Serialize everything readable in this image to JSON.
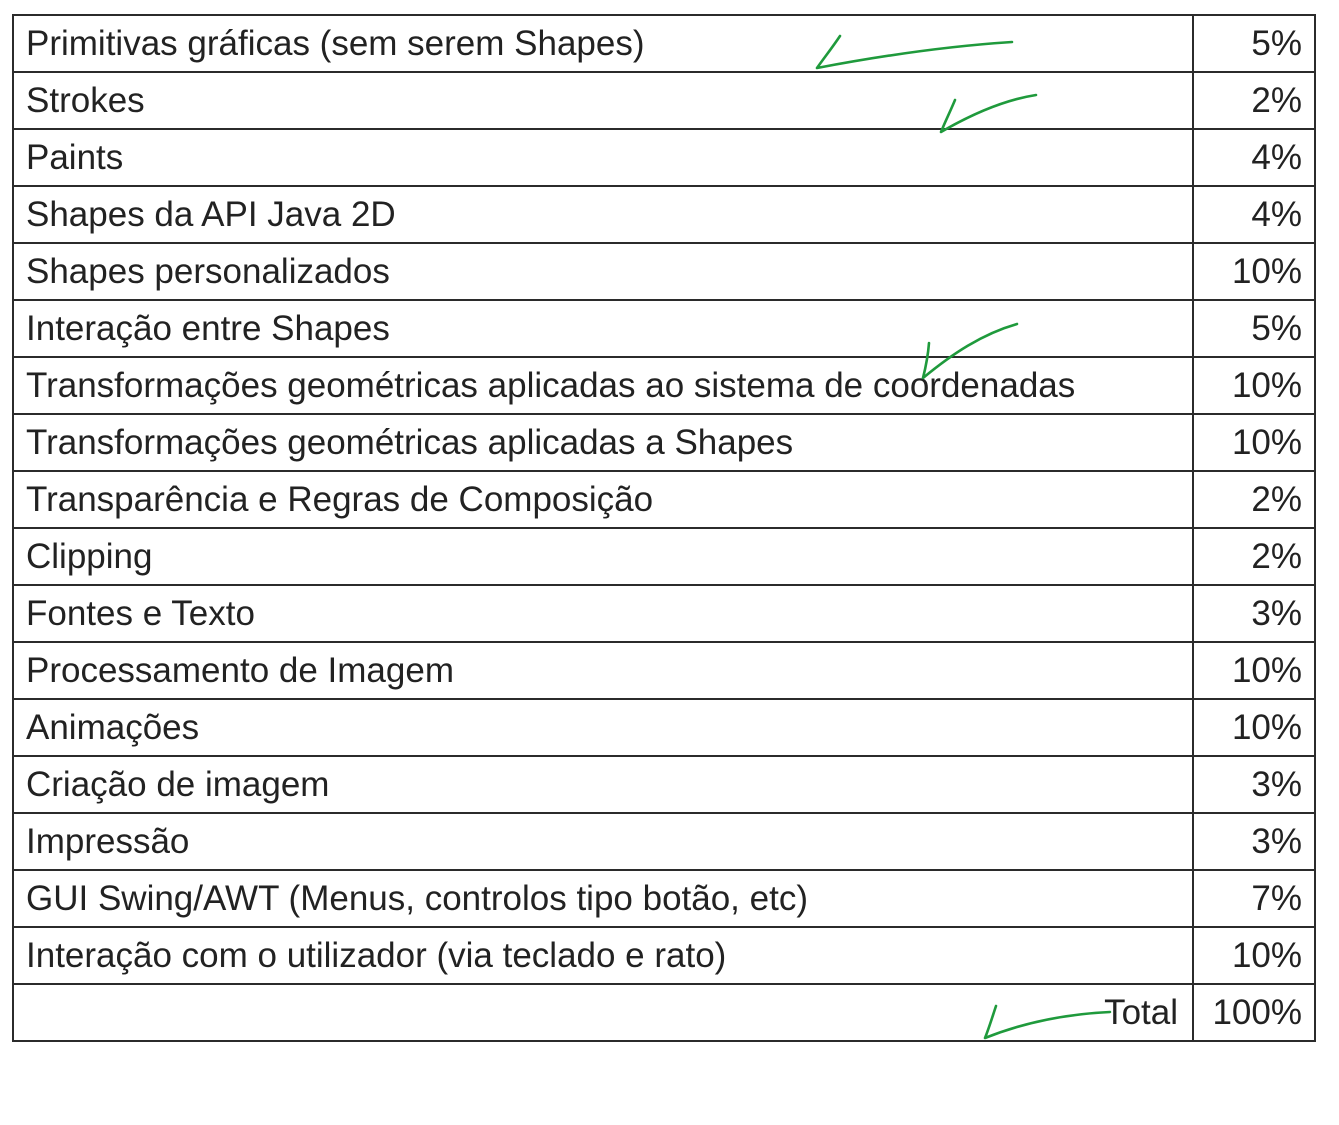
{
  "table": {
    "rows": [
      {
        "topic": "Primitivas gráficas (sem serem Shapes)",
        "weight": "5%",
        "checked": true
      },
      {
        "topic": "Strokes",
        "weight": "2%",
        "checked": true
      },
      {
        "topic": "Paints",
        "weight": "4%",
        "checked": false
      },
      {
        "topic": "Shapes da API Java 2D",
        "weight": "4%",
        "checked": false
      },
      {
        "topic": "Shapes personalizados",
        "weight": "10%",
        "checked": false
      },
      {
        "topic": "Interação entre Shapes",
        "weight": "5%",
        "checked": true
      },
      {
        "topic": "Transformações geométricas aplicadas ao sistema de coordenadas",
        "weight": "10%",
        "checked": false
      },
      {
        "topic": "Transformações geométricas aplicadas a Shapes",
        "weight": "10%",
        "checked": false
      },
      {
        "topic": "Transparência e Regras de Composição",
        "weight": "2%",
        "checked": false
      },
      {
        "topic": "Clipping",
        "weight": "2%",
        "checked": false
      },
      {
        "topic": "Fontes e Texto",
        "weight": "3%",
        "checked": false
      },
      {
        "topic": "Processamento de Imagem",
        "weight": "10%",
        "checked": false
      },
      {
        "topic": "Animações",
        "weight": "10%",
        "checked": false
      },
      {
        "topic": "Criação de imagem",
        "weight": "3%",
        "checked": false
      },
      {
        "topic": "Impressão",
        "weight": "3%",
        "checked": false
      },
      {
        "topic": "GUI Swing/AWT (Menus, controlos tipo botão, etc)",
        "weight": "7%",
        "checked": false
      },
      {
        "topic": "Interação com o utilizador (via teclado e rato)",
        "weight": "10%",
        "checked": true
      }
    ],
    "total_label": "Total",
    "total_value": "100%"
  },
  "annotation_color": "#1f9a3c",
  "annotation_icon": "checkmark-icon"
}
